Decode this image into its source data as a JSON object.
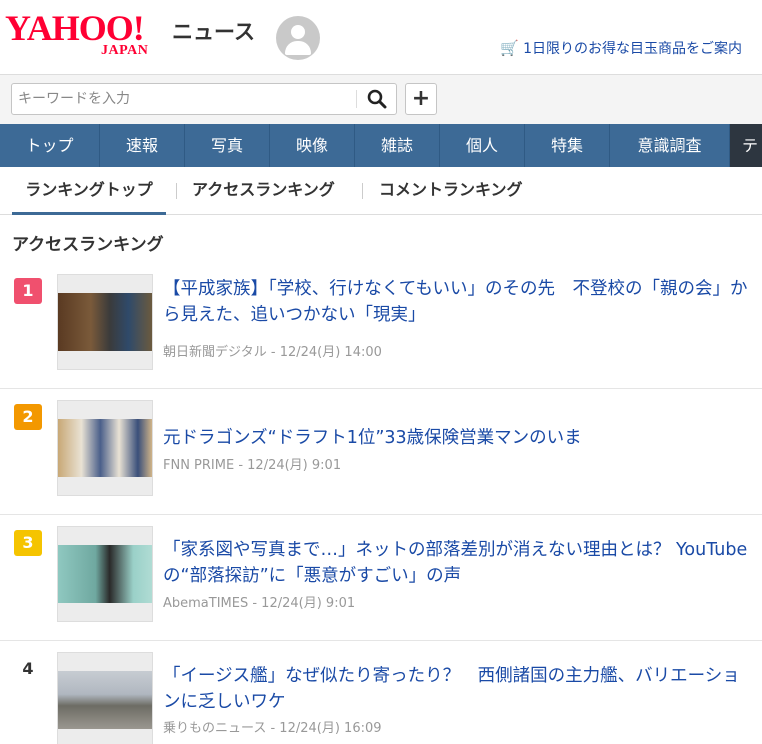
{
  "header": {
    "logo_main": "YAHOO!",
    "logo_sub": "JAPAN",
    "service_name": "ニュース",
    "promo_text": "1日限りのお得な目玉商品をご案内"
  },
  "search": {
    "placeholder": "キーワードを入力"
  },
  "nav": {
    "items": [
      "トップ",
      "速報",
      "写真",
      "映像",
      "雑誌",
      "個人",
      "特集",
      "意識調査",
      "テ"
    ]
  },
  "tabs": {
    "items": [
      "ランキングトップ",
      "アクセスランキング",
      "コメントランキング"
    ]
  },
  "ranking": {
    "section_title": "アクセスランキング",
    "items": [
      {
        "rank": "1",
        "rank_color": "#f0506e",
        "headline": "【平成家族】「学校、行けなくてもいい」のその先　不登校の「親の会」から見えた、追いつかない「現実」",
        "meta": "朝日新聞デジタル - 12/24(月) 14:00"
      },
      {
        "rank": "2",
        "rank_color": "#f39800",
        "headline": "元ドラゴンズ“ドラフト1位”33歳保険営業マンのいま",
        "meta": "FNN PRIME - 12/24(月) 9:01"
      },
      {
        "rank": "3",
        "rank_color": "#f5c400",
        "headline": "「家系図や写真まで…」ネットの部落差別が消えない理由とは？ YouTubeの“部落探訪”に「悪意がすごい」の声",
        "meta": "AbemaTIMES - 12/24(月) 9:01"
      },
      {
        "rank": "4",
        "headline": "「イージス艦」なぜ似たり寄ったり？　西側諸国の主力艦、バリエーションに乏しいワケ",
        "meta": "乗りものニュース - 12/24(月) 16:09"
      }
    ]
  }
}
